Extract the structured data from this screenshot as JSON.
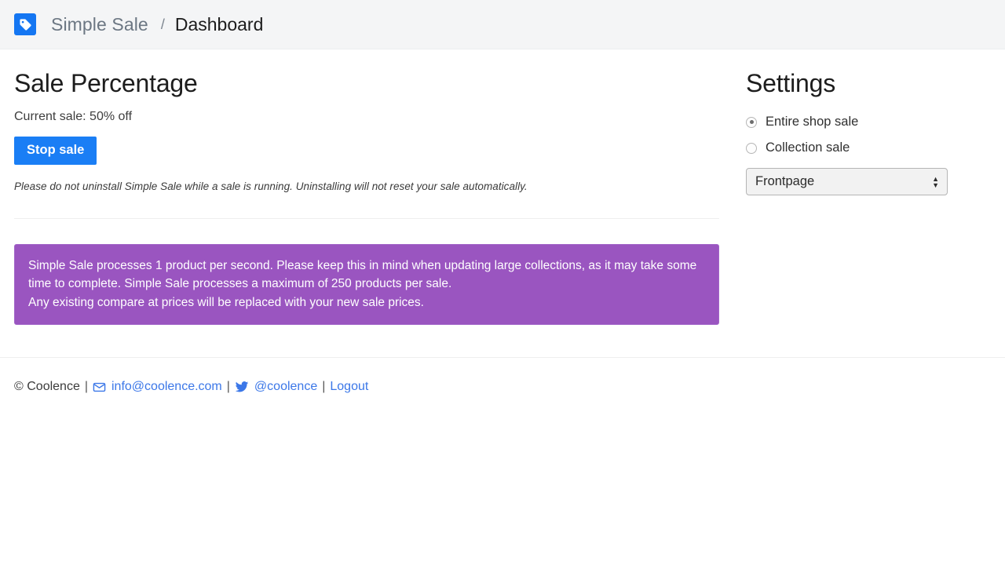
{
  "header": {
    "logo_icon": "price-tag-icon",
    "brand": "Simple Sale",
    "separator": "/",
    "current_page": "Dashboard",
    "brand_color": "#1476f2",
    "bar_bg": "#f4f5f6"
  },
  "main": {
    "title": "Sale Percentage",
    "current_sale": "Current sale: 50% off",
    "stop_button": "Stop sale",
    "stop_button_color": "#1a7ef5",
    "warning_note": "Please do not uninstall Simple Sale while a sale is running. Uninstalling will not reset your sale automatically.",
    "alert": {
      "color": "#9a55c0",
      "lines": [
        "Simple Sale processes 1 product per second. Please keep this in mind when updating large collections, as it may take some time to complete. Simple Sale processes a maximum of 250 products per sale.",
        "Any existing compare at prices will be replaced with your new sale prices."
      ]
    }
  },
  "settings": {
    "title": "Settings",
    "options": [
      {
        "label": "Entire shop sale",
        "checked": true
      },
      {
        "label": "Collection sale",
        "checked": false
      }
    ],
    "collection_select": {
      "value": "Frontpage",
      "arrow_up": "▲",
      "arrow_down": "▼"
    }
  },
  "footer": {
    "copyright": "© Coolence",
    "sep1": "|",
    "email_icon": "envelope-icon",
    "email": "info@coolence.com",
    "sep2": "|",
    "twitter_icon": "twitter-bird-icon",
    "twitter": "@coolence",
    "sep3": "|",
    "logout": "Logout",
    "link_color": "#3b77e8"
  }
}
